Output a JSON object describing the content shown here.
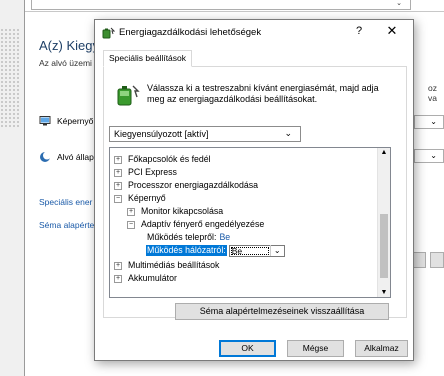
{
  "background": {
    "heading": "A(z) Kiegy",
    "subtitle": "Az alvó üzemi",
    "rows": [
      {
        "label": "Képernyő"
      },
      {
        "label": "Alvó állap"
      }
    ],
    "links": [
      "Speciális ener",
      "Séma alapérte"
    ],
    "right_text": [
      "oz",
      "va"
    ]
  },
  "dialog": {
    "title": "Energiagazdálkodási lehetőségek",
    "help_glyph": "?",
    "close_glyph": "✕",
    "tab_label": "Speciális beállítások",
    "intro": "Válassza ki a testreszabni kívánt energiasémát, majd adja meg az energiagazdálkodási beállításokat.",
    "plan_select": "Kiegyensúlyozott [aktív]",
    "tree": {
      "items": [
        {
          "expander": "⊞",
          "label": "Főkapcsolók és fedél"
        },
        {
          "expander": "⊞",
          "label": "PCI Express"
        },
        {
          "expander": "⊞",
          "label": "Processzor energiagazdálkodása"
        },
        {
          "expander": "⊟",
          "label": "Képernyő"
        },
        {
          "expander": "⊞",
          "label": "Monitor kikapcsolása"
        },
        {
          "expander": "⊟",
          "label": "Adaptív fényerő engedélyezése"
        },
        {
          "label": "Működés telepről:",
          "value": "Be"
        },
        {
          "label": "Működés hálózatról:",
          "value": "Be"
        },
        {
          "expander": "⊞",
          "label": "Multimédiás beállítások"
        },
        {
          "expander": "⊞",
          "label": "Akkumulátor"
        }
      ]
    },
    "restore_button": "Séma alapértelmezéseinek visszaállítása",
    "buttons": {
      "ok": "OK",
      "cancel": "Mégse",
      "apply": "Alkalmaz"
    }
  },
  "colors": {
    "selection": "#0078d7",
    "link": "#1a5aa8",
    "heading": "#1e3f66"
  },
  "icons": [
    "power-options-icon",
    "battery-plug-icon",
    "monitor-icon",
    "moon-sleep-icon",
    "chevron-down-icon",
    "expand-plus-icon",
    "collapse-minus-icon"
  ]
}
